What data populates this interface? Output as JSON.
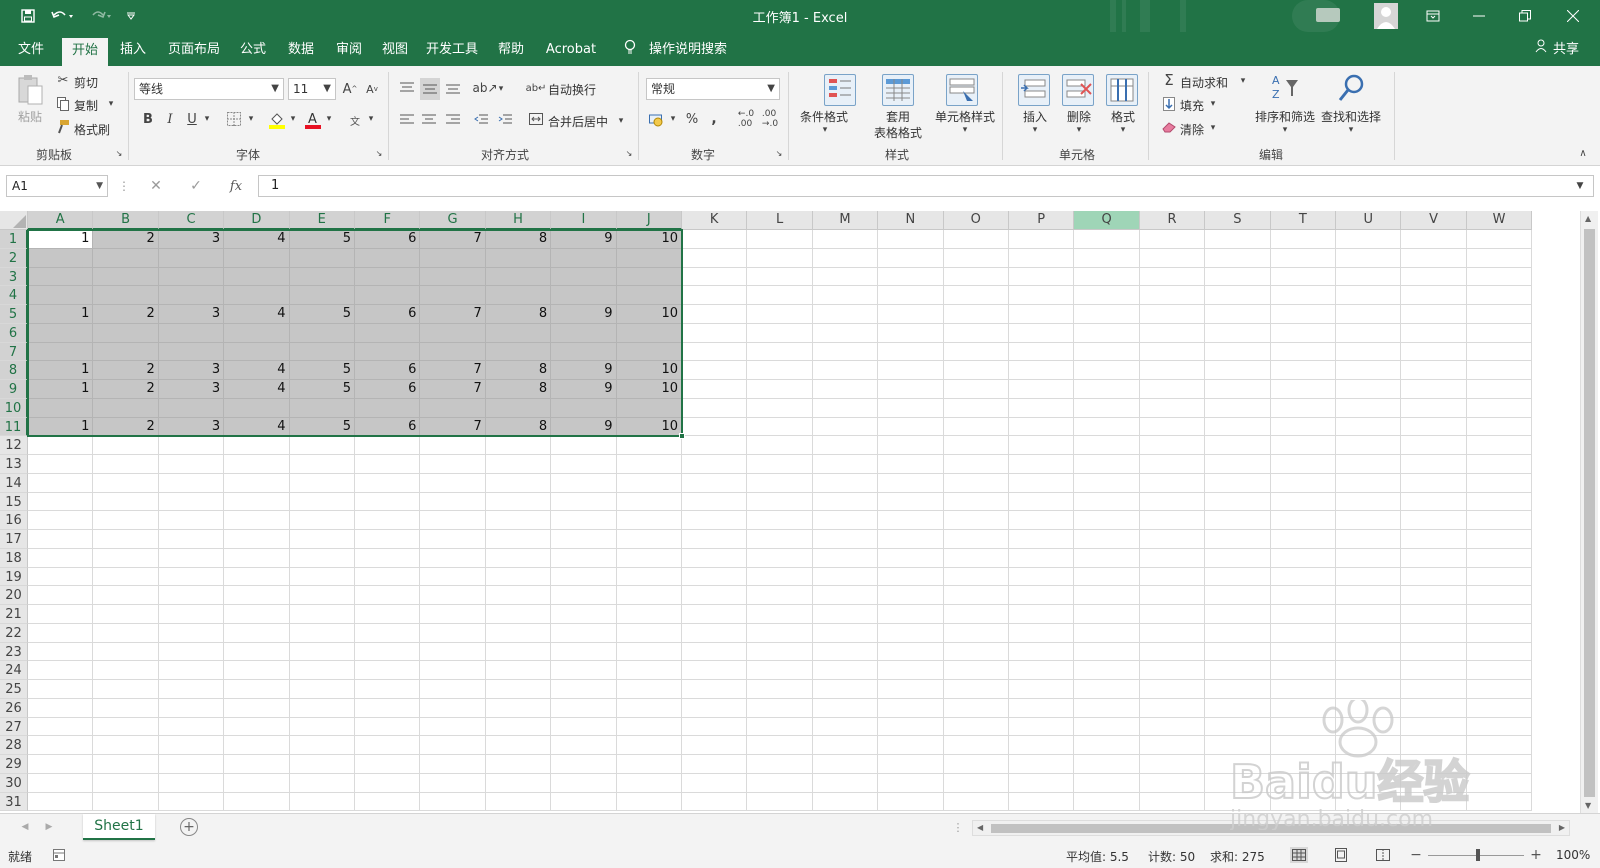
{
  "titlebar": {
    "title": "工作簿1  -  Excel",
    "save_icon": "save-icon",
    "undo_icon": "undo-icon",
    "redo_icon": "redo-icon",
    "customize_icon": "customize-qat-icon",
    "ribbon_display_icon": "ribbon-display-icon",
    "minimize_icon": "minimize-icon",
    "restore_icon": "restore-icon",
    "close_icon": "close-icon"
  },
  "menu": {
    "tabs": [
      "文件",
      "开始",
      "插入",
      "页面布局",
      "公式",
      "数据",
      "审阅",
      "视图",
      "开发工具",
      "帮助",
      "Acrobat"
    ],
    "active": "开始",
    "tell_me": "操作说明搜索",
    "share": "共享"
  },
  "ribbon": {
    "clipboard": {
      "paste": "粘贴",
      "cut": "剪切",
      "copy": "复制",
      "format_painter": "格式刷",
      "label": "剪贴板"
    },
    "font": {
      "name": "等线",
      "size": "11",
      "label": "字体",
      "bold": "B",
      "italic": "I",
      "underline": "U"
    },
    "alignment": {
      "wrap": "自动换行",
      "merge": "合并后居中",
      "label": "对齐方式"
    },
    "number": {
      "format": "常规",
      "percent": "%",
      "comma": ",",
      "label": "数字"
    },
    "styles": {
      "conditional": "条件格式",
      "table_line1": "套用",
      "table_line2": "表格格式",
      "cell_styles": "单元格样式",
      "label": "样式"
    },
    "cells": {
      "insert": "插入",
      "delete": "删除",
      "format": "格式",
      "label": "单元格"
    },
    "editing": {
      "autosum": "自动求和",
      "fill": "填充",
      "clear": "清除",
      "sort": "排序和筛选",
      "find": "查找和选择",
      "label": "编辑"
    }
  },
  "formula_bar": {
    "name_box": "A1",
    "value": "1",
    "fx": "fx"
  },
  "grid": {
    "columns": [
      "A",
      "B",
      "C",
      "D",
      "E",
      "F",
      "G",
      "H",
      "I",
      "J",
      "K",
      "L",
      "M",
      "N",
      "O",
      "P",
      "Q",
      "R",
      "S",
      "T",
      "U",
      "V",
      "W"
    ],
    "rows": [
      "1",
      "2",
      "3",
      "4",
      "5",
      "6",
      "7",
      "8",
      "9",
      "10",
      "11",
      "12",
      "13",
      "14",
      "15",
      "16",
      "17",
      "18",
      "19",
      "20",
      "21",
      "22",
      "23",
      "24",
      "25",
      "26",
      "27",
      "28",
      "29",
      "30",
      "31"
    ],
    "filled_rows": [
      "1",
      "5",
      "8",
      "9",
      "11"
    ],
    "values": [
      "1",
      "2",
      "3",
      "4",
      "5",
      "6",
      "7",
      "8",
      "9",
      "10"
    ],
    "selection": "A1:J11",
    "highlighted_column": "Q"
  },
  "sheets": {
    "tabs": [
      "Sheet1"
    ],
    "active": "Sheet1"
  },
  "status": {
    "ready": "就绪",
    "average": "平均值: 5.5",
    "count": "计数: 50",
    "sum": "求和: 275",
    "zoom": "100%"
  },
  "watermark": {
    "line1": "Baidu经验",
    "line2": "jingyan.baidu.com"
  },
  "colors": {
    "accent": "#217346",
    "selection_fill": "#c6c6c6",
    "column_highlight": "#9fd5b7"
  }
}
